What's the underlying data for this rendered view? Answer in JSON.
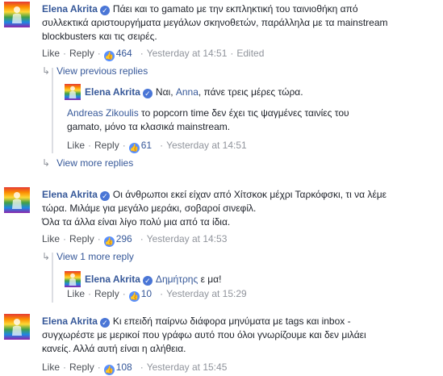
{
  "author": "Elena Akrita",
  "comments": [
    {
      "text_lines": [
        "Πάει και το gamato με την εκπληκτική του ταινιοθήκη από",
        "συλλεκτικά αριστουργήματα μεγάλων σκηνοθετών, παράλληλα με τα mainstream",
        "blockbusters και τις σειρές."
      ],
      "like": "Like",
      "reply": "Reply",
      "count": "464",
      "time": "Yesterday at 14:51",
      "edited": "Edited"
    },
    {
      "text_lines": [
        "Οι άνθρωποι εκεί είχαν από Χίτσκοκ μέχρι Ταρκόφσκι, τι να λέμε",
        "τώρα. Μιλάμε για μεγάλο μεράκι, σοβαροί σινεφίλ.",
        "Όλα τα άλλα είναι λίγο πολύ μια από τα ίδια."
      ],
      "like": "Like",
      "reply": "Reply",
      "count": "296",
      "time": "Yesterday at 14:53"
    },
    {
      "text_lines": [
        "Κι επειδή παίρνω διάφορα μηνύματα με tags και inbox -",
        "συγχωρέστε με μερικοί που γράφω αυτό που όλοι γνωρίζουμε και δεν μιλάει",
        "κανείς. Αλλά αυτή είναι η αλήθεια."
      ],
      "like": "Like",
      "reply": "Reply",
      "count": "108",
      "time": "Yesterday at 15:45"
    }
  ],
  "replies": [
    {
      "prefix": "Ναι, ",
      "mention": "Anna",
      "suffix": ", πάνε τρεις μέρες τώρα.",
      "quote_author": "Andreas Zikoulis",
      "quote_lines": [
        " το popcorn time δεν έχει τις ψαγμένες ταινίες του",
        "gamato, μόνο τα κλασικά mainstream."
      ],
      "like": "Like",
      "reply": "Reply",
      "count": "61",
      "time": "Yesterday at 14:51"
    },
    {
      "prefix": "",
      "mention": "Δημήτρης",
      "suffix": " ε μα!",
      "like": "Like",
      "reply": "Reply",
      "count": "10",
      "time": "Yesterday at 15:29"
    }
  ],
  "links": {
    "view_previous": "View previous replies",
    "view_more": "View more replies",
    "view_one_more": "View 1 more reply"
  },
  "icons": {
    "verified": "verified-check-icon",
    "like": "thumbs-up-icon",
    "arrow": "reply-arrow-icon"
  },
  "colors": {
    "link": "#365899",
    "meta": "#90949c",
    "verified": "#4a76d6"
  }
}
